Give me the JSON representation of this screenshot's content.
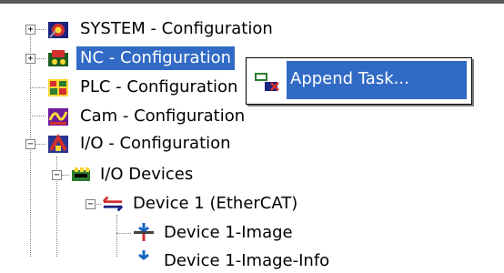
{
  "tree": {
    "items": [
      {
        "label": "SYSTEM - Configuration",
        "icon": "system-config-icon",
        "expander": "+"
      },
      {
        "label": "NC - Configuration",
        "icon": "nc-config-icon",
        "expander": "+",
        "selected": true
      },
      {
        "label": "PLC - Configuration",
        "icon": "plc-config-icon"
      },
      {
        "label": "Cam - Configuration",
        "icon": "cam-config-icon"
      },
      {
        "label": "I/O - Configuration",
        "icon": "io-config-icon",
        "expander": "−"
      },
      {
        "label": "I/O Devices",
        "icon": "io-devices-icon",
        "expander": "−"
      },
      {
        "label": "Device 1 (EtherCAT)",
        "icon": "ethercat-device-icon",
        "expander": "−"
      },
      {
        "label": "Device 1-Image",
        "icon": "process-image-icon"
      },
      {
        "label": "Device 1-Image-Info",
        "icon": "process-image-icon"
      }
    ]
  },
  "context_menu": {
    "items": [
      {
        "label": "Append Task...",
        "icon": "append-task-icon"
      }
    ]
  },
  "colors": {
    "selection": "#316ac5",
    "selection_text": "#ffffff"
  }
}
